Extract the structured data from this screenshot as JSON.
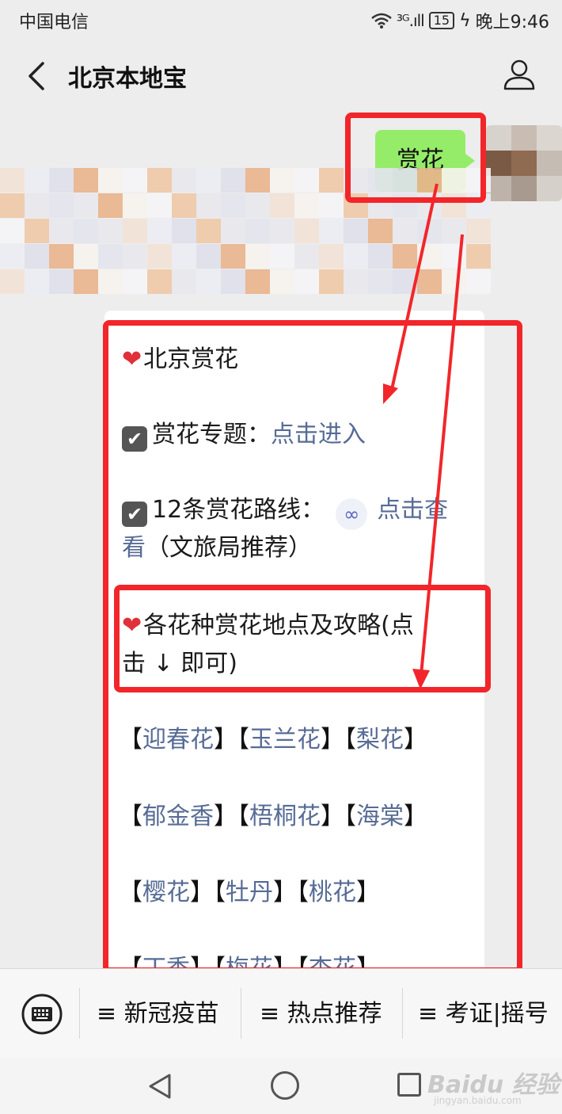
{
  "status_bar": {
    "carrier": "中国电信",
    "signal": "³ᴳ.ıll",
    "battery": "15",
    "time": "晚上9:46"
  },
  "header": {
    "title": "北京本地宝"
  },
  "chat": {
    "my_message": "赏花",
    "reply": {
      "title": "北京赏花",
      "topic_label": "赏花专题：",
      "topic_link": "点击进入",
      "routes_label": "12条赏花路线：",
      "routes_link_a": "点击查",
      "routes_link_b": "看",
      "routes_note": "（文旅局推荐）",
      "guide_line1": "各花种赏花地点及攻略(点",
      "guide_line2": "击 ↓ 即可)",
      "flowers": [
        [
          "迎春花",
          "玉兰花",
          "梨花"
        ],
        [
          "郁金香",
          "梧桐花",
          "海棠"
        ],
        [
          "樱花",
          "牡丹",
          "桃花"
        ],
        [
          "丁香",
          "梅花",
          "杏花"
        ]
      ]
    }
  },
  "menu": {
    "items": [
      "≡ 新冠疫苗",
      "≡ 热点推荐",
      "≡ 考证|摇号"
    ]
  },
  "watermark": {
    "brand": "Baidu 经验",
    "url": "jingyan.baidu.com"
  },
  "colors": {
    "bubble_green": "#95ec69",
    "link_blue": "#576b95",
    "annotation_red": "#f2262a"
  }
}
